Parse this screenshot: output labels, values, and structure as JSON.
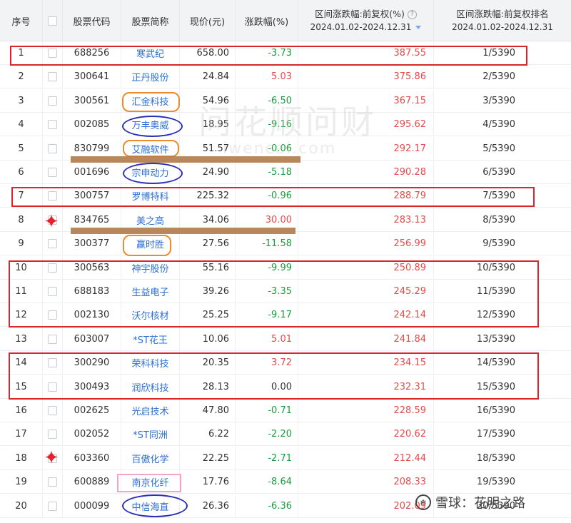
{
  "headers": {
    "idx": "序号",
    "code": "股票代码",
    "name": "股票简称",
    "price": "现价(元)",
    "chg": "涨跌幅(%)",
    "range_title": "区间涨跌幅:前复权(%)",
    "range_date": "2024.01.02-2024.12.31",
    "rank_title": "区间涨跌幅:前复权排名",
    "rank_date": "2024.01.02-2024.12.31"
  },
  "watermark": {
    "main": "问花顺问财",
    "sub": "iwencai.com"
  },
  "footer": {
    "text": "雪球：花明之路"
  },
  "rows": [
    {
      "idx": "1",
      "code": "688256",
      "name": "寒武纪",
      "price": "658.00",
      "chg": "-3.73",
      "dir": "down",
      "range": "387.55",
      "rank": "1/5390"
    },
    {
      "idx": "2",
      "code": "300641",
      "name": "正丹股份",
      "price": "24.84",
      "chg": "5.03",
      "dir": "up",
      "range": "375.86",
      "rank": "2/5390"
    },
    {
      "idx": "3",
      "code": "300561",
      "name": "汇金科技",
      "price": "54.96",
      "chg": "-6.50",
      "dir": "down",
      "range": "367.15",
      "rank": "3/5390"
    },
    {
      "idx": "4",
      "code": "002085",
      "name": "万丰奥威",
      "price": "18.95",
      "chg": "-9.16",
      "dir": "down",
      "range": "295.62",
      "rank": "4/5390"
    },
    {
      "idx": "5",
      "code": "830799",
      "name": "艾融软件",
      "price": "51.57",
      "chg": "-0.06",
      "dir": "down",
      "range": "292.17",
      "rank": "5/5390"
    },
    {
      "idx": "6",
      "code": "001696",
      "name": "宗申动力",
      "price": "24.90",
      "chg": "-5.18",
      "dir": "down",
      "range": "290.28",
      "rank": "6/5390"
    },
    {
      "idx": "7",
      "code": "300757",
      "name": "罗博特科",
      "price": "225.32",
      "chg": "-0.96",
      "dir": "down",
      "range": "288.79",
      "rank": "7/5390"
    },
    {
      "idx": "8",
      "code": "834765",
      "name": "美之高",
      "price": "34.06",
      "chg": "30.00",
      "dir": "up",
      "range": "283.13",
      "rank": "8/5390"
    },
    {
      "idx": "9",
      "code": "300377",
      "name": "赢时胜",
      "price": "27.56",
      "chg": "-11.58",
      "dir": "down",
      "range": "256.99",
      "rank": "9/5390"
    },
    {
      "idx": "10",
      "code": "300563",
      "name": "神宇股份",
      "price": "55.16",
      "chg": "-9.99",
      "dir": "down",
      "range": "250.89",
      "rank": "10/5390"
    },
    {
      "idx": "11",
      "code": "688183",
      "name": "生益电子",
      "price": "39.26",
      "chg": "-3.35",
      "dir": "down",
      "range": "245.29",
      "rank": "11/5390"
    },
    {
      "idx": "12",
      "code": "002130",
      "name": "沃尔核材",
      "price": "25.25",
      "chg": "-9.17",
      "dir": "down",
      "range": "242.14",
      "rank": "12/5390"
    },
    {
      "idx": "13",
      "code": "603007",
      "name": "*ST花王",
      "price": "10.06",
      "chg": "5.01",
      "dir": "up",
      "range": "241.84",
      "rank": "13/5390"
    },
    {
      "idx": "14",
      "code": "300290",
      "name": "荣科科技",
      "price": "20.35",
      "chg": "3.72",
      "dir": "up",
      "range": "234.15",
      "rank": "14/5390"
    },
    {
      "idx": "15",
      "code": "300493",
      "name": "润欣科技",
      "price": "28.13",
      "chg": "0.00",
      "dir": "flat",
      "range": "232.31",
      "rank": "15/5390"
    },
    {
      "idx": "16",
      "code": "002625",
      "name": "光启技术",
      "price": "47.80",
      "chg": "-0.71",
      "dir": "down",
      "range": "228.59",
      "rank": "16/5390"
    },
    {
      "idx": "17",
      "code": "002052",
      "name": "*ST同洲",
      "price": "6.22",
      "chg": "-2.20",
      "dir": "down",
      "range": "220.62",
      "rank": "17/5390"
    },
    {
      "idx": "18",
      "code": "603360",
      "name": "百傲化学",
      "price": "22.25",
      "chg": "-2.71",
      "dir": "down",
      "range": "212.44",
      "rank": "18/5390"
    },
    {
      "idx": "19",
      "code": "600889",
      "name": "南京化纤",
      "price": "17.76",
      "chg": "-8.64",
      "dir": "down",
      "range": "208.33",
      "rank": "19/5390"
    },
    {
      "idx": "20",
      "code": "000099",
      "name": "中信海直",
      "price": "26.36",
      "chg": "-6.36",
      "dir": "down",
      "range": "202.09",
      "rank": "20/5390"
    }
  ]
}
